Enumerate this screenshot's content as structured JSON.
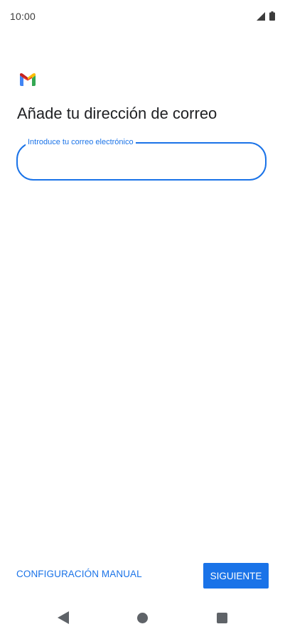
{
  "status_bar": {
    "time": "10:00",
    "icons": [
      "signal-icon",
      "battery-icon"
    ]
  },
  "header": {
    "logo": "gmail-logo-icon",
    "title": "Añade tu dirección de correo"
  },
  "email_field": {
    "label": "Introduce tu correo electrónico",
    "value": ""
  },
  "actions": {
    "manual_label": "CONFIGURACIÓN MANUAL",
    "next_label": "SIGUIENTE"
  },
  "nav_bar": {
    "icons": [
      "back-icon",
      "home-icon",
      "recents-icon"
    ]
  },
  "colors": {
    "accent": "#1a73e8",
    "text": "#202124",
    "nav": "#5f6368"
  }
}
